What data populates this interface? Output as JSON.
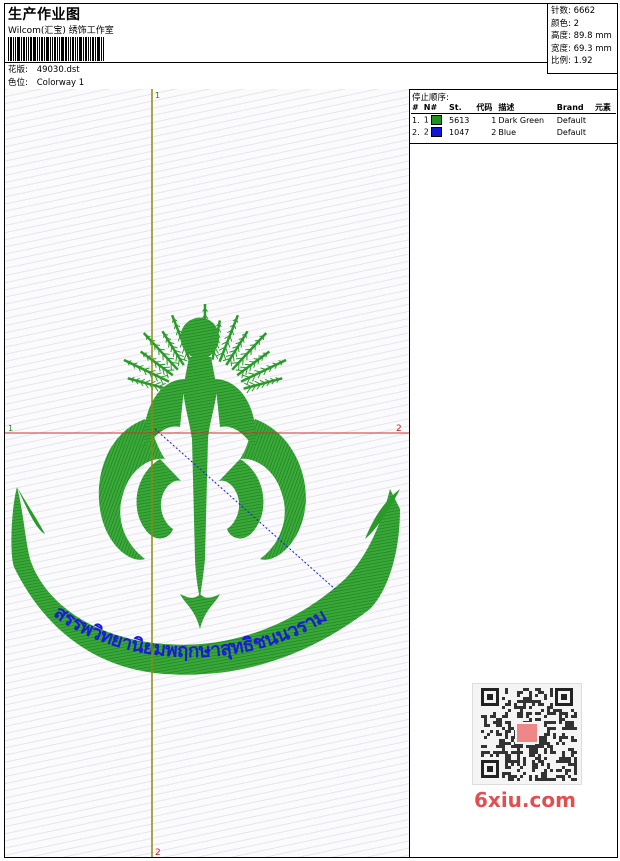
{
  "header": {
    "title": "生产作业图",
    "subtitle": "Wilcom(汇宝) 绣饰工作室",
    "design_label": "花版:",
    "design_value": "49030.dst",
    "colorway_label": "色位:",
    "colorway_value": "Colorway 1"
  },
  "stats": [
    {
      "label": "针数:",
      "value": "6662"
    },
    {
      "label": "颜色:",
      "value": "2"
    },
    {
      "label": "高度:",
      "value": "89.8 mm"
    },
    {
      "label": "宽度:",
      "value": "69.3 mm"
    },
    {
      "label": "比例:",
      "value": "1.92"
    }
  ],
  "stop_sequence": {
    "title": "停止顺序:",
    "columns": [
      "#",
      "N#",
      "St.",
      "代码",
      "描述",
      "Brand",
      "元素"
    ],
    "rows": [
      {
        "idx": "1.",
        "n": "1",
        "color": "#1f8f1f",
        "st": "5613",
        "code": "1",
        "desc": "Dark Green",
        "brand": "Default"
      },
      {
        "idx": "2.",
        "n": "2",
        "color": "#1515d8",
        "st": "1047",
        "code": "2",
        "desc": "Blue",
        "brand": "Default"
      }
    ]
  },
  "guides": {
    "v_top": "1",
    "v_bottom": "2",
    "h_left": "1",
    "h_right": "2"
  },
  "embroidery": {
    "banner_text": "สรรพวิทยานิยมพฤกษาสุทธิชนนวราม",
    "thread_green": "#2a9a2a",
    "thread_blue": "#1a1ad8"
  },
  "watermark": {
    "text": "6xiu.com"
  }
}
